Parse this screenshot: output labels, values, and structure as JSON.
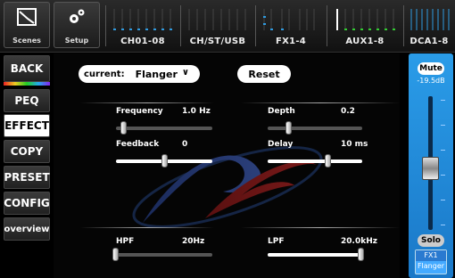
{
  "topbar": {
    "scenes_label": "Scenes",
    "setup_label": "Setup",
    "tabs": [
      {
        "label": "CH01-08"
      },
      {
        "label": "CH/ST/USB"
      },
      {
        "label": "FX1-4"
      },
      {
        "label": "AUX1-8"
      },
      {
        "label": "DCA1-8"
      }
    ]
  },
  "nav": {
    "items": [
      {
        "label": "BACK"
      },
      {
        "label": "PEQ"
      },
      {
        "label": "EFFECT"
      },
      {
        "label": "COPY"
      },
      {
        "label": "PRESET"
      },
      {
        "label": "CONFIG"
      },
      {
        "label": "overview"
      }
    ],
    "active": "EFFECT"
  },
  "effect": {
    "current_label": "current:",
    "current_value": "Flanger",
    "reset_label": "Reset",
    "params": {
      "frequency": {
        "label": "Frequency",
        "value": "1.0 Hz",
        "level": 0.05
      },
      "depth": {
        "label": "Depth",
        "value": "0.2",
        "level": 0.2
      },
      "feedback": {
        "label": "Feedback",
        "value": "0",
        "level": 0.5
      },
      "delay": {
        "label": "Delay",
        "value": "10 ms",
        "level": 0.65
      },
      "hpf": {
        "label": "HPF",
        "value": "20Hz",
        "level": 0.0
      },
      "lpf": {
        "label": "LPF",
        "value": "20.0kHz",
        "level": 1.0
      }
    }
  },
  "channel": {
    "mute_label": "Mute",
    "gain": "-19.5dB",
    "solo_label": "Solo",
    "name_top": "FX1",
    "name_bottom": "Flanger"
  },
  "colors": {
    "strip": "#2a9ce8",
    "meter": "#2f9be0",
    "meter_green": "#3c3"
  }
}
